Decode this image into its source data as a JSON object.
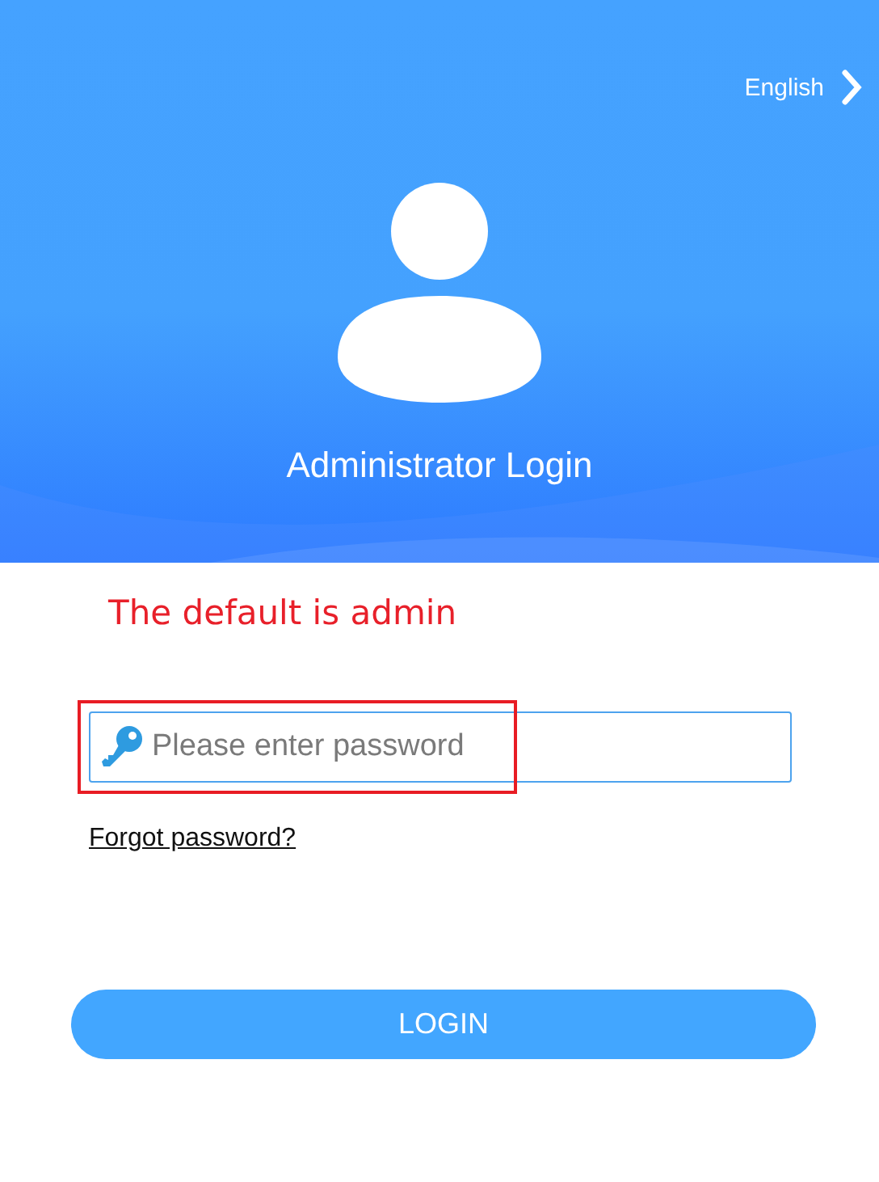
{
  "header": {
    "language": "English",
    "title": "Administrator Login"
  },
  "note": "The default is admin",
  "password_field": {
    "placeholder": "Please enter password",
    "highlighted": true
  },
  "forgot_link": "Forgot password?",
  "login_button": "LOGIN"
}
